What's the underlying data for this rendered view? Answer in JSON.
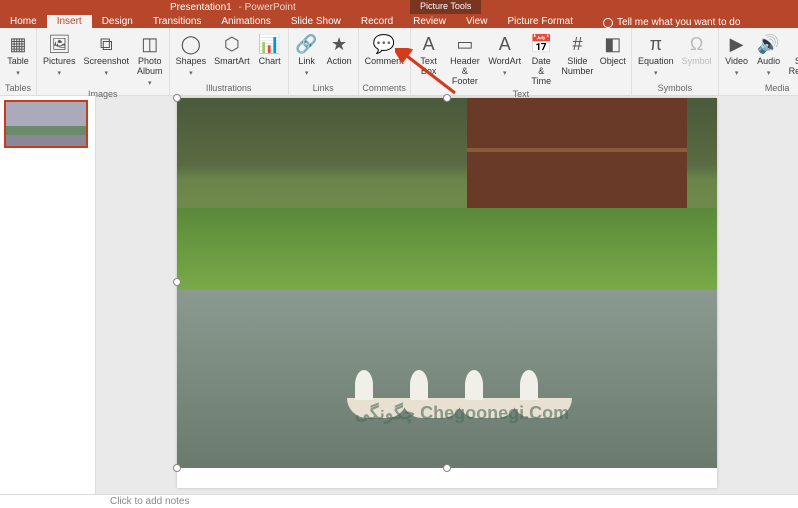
{
  "title": {
    "doc": "Presentation1",
    "app": "PowerPoint"
  },
  "picture_tools_label": "Picture Tools",
  "tabs": [
    "Home",
    "Insert",
    "Design",
    "Transitions",
    "Animations",
    "Slide Show",
    "Record",
    "Review",
    "View",
    "Picture Format"
  ],
  "active_tab": "Insert",
  "tell_me": "Tell me what you want to do",
  "groups": {
    "tables": {
      "label": "Tables",
      "items": [
        {
          "name": "table",
          "label": "Table",
          "chev": true
        }
      ]
    },
    "images": {
      "label": "Images",
      "items": [
        {
          "name": "pictures",
          "label": "Pictures",
          "chev": true
        },
        {
          "name": "screenshot",
          "label": "Screenshot",
          "chev": true
        },
        {
          "name": "photo-album",
          "label": "Photo\nAlbum",
          "chev": true
        }
      ]
    },
    "illustrations": {
      "label": "Illustrations",
      "items": [
        {
          "name": "shapes",
          "label": "Shapes",
          "chev": true
        },
        {
          "name": "smartart",
          "label": "SmartArt"
        },
        {
          "name": "chart",
          "label": "Chart"
        }
      ]
    },
    "links": {
      "label": "Links",
      "items": [
        {
          "name": "link",
          "label": "Link",
          "chev": true
        },
        {
          "name": "action",
          "label": "Action"
        }
      ]
    },
    "comments": {
      "label": "Comments",
      "items": [
        {
          "name": "comment",
          "label": "Comment"
        }
      ]
    },
    "text": {
      "label": "Text",
      "items": [
        {
          "name": "text-box",
          "label": "Text\nBox"
        },
        {
          "name": "header-footer",
          "label": "Header\n& Footer"
        },
        {
          "name": "wordart",
          "label": "WordArt",
          "chev": true
        },
        {
          "name": "date-time",
          "label": "Date &\nTime"
        },
        {
          "name": "slide-number",
          "label": "Slide\nNumber"
        },
        {
          "name": "object",
          "label": "Object"
        }
      ]
    },
    "symbols": {
      "label": "Symbols",
      "items": [
        {
          "name": "equation",
          "label": "Equation",
          "chev": true
        },
        {
          "name": "symbol",
          "label": "Symbol",
          "disabled": true
        }
      ]
    },
    "media": {
      "label": "Media",
      "items": [
        {
          "name": "video",
          "label": "Video",
          "chev": true
        },
        {
          "name": "audio",
          "label": "Audio",
          "chev": true
        },
        {
          "name": "screen-recording",
          "label": "Screen\nRecording"
        }
      ]
    }
  },
  "icons": {
    "table": "▦",
    "pictures": "🖼",
    "screenshot": "⧉",
    "photo-album": "◫",
    "shapes": "◯",
    "smartart": "⬡",
    "chart": "📊",
    "link": "🔗",
    "action": "★",
    "comment": "💬",
    "text-box": "A",
    "header-footer": "▭",
    "wordart": "A",
    "date-time": "📅",
    "slide-number": "#",
    "object": "◧",
    "equation": "π",
    "symbol": "Ω",
    "video": "▶",
    "audio": "🔊",
    "screen-recording": "⦿"
  },
  "notes_placeholder": "Click to add notes",
  "watermark_text": "چگونگی Chegoonegi.Com"
}
